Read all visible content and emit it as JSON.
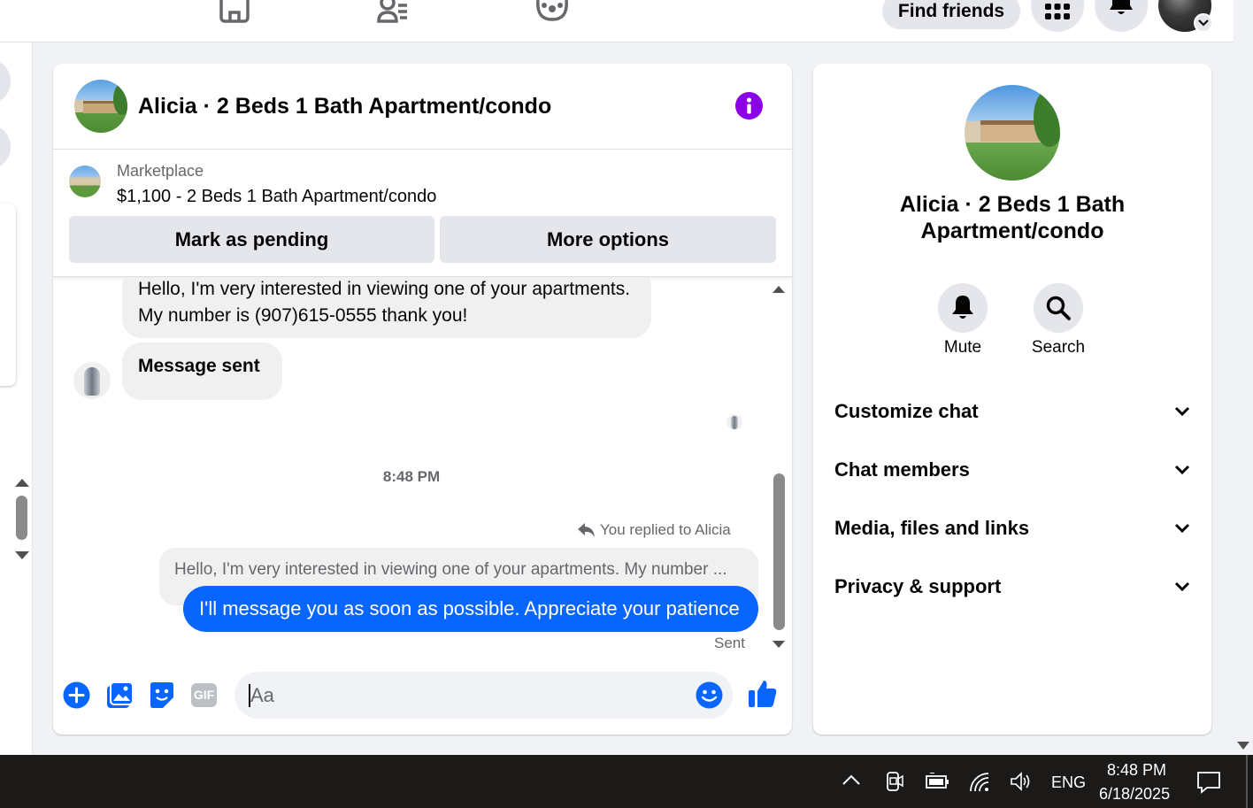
{
  "topbar": {
    "find_friends": "Find friends",
    "nav_icons": [
      "home-icon",
      "friends-icon",
      "groups-icon"
    ],
    "right_icons": [
      "menu-grid-icon",
      "notifications-bell-icon",
      "account-avatar"
    ]
  },
  "chat": {
    "header_title": "Alicia · 2 Beds 1 Bath Apartment/condo",
    "marketplace_label": "Marketplace",
    "listing_text": "$1,100 - 2 Beds 1 Bath Apartment/condo",
    "mark_pending": "Mark as pending",
    "more_options": "More options",
    "messages": [
      {
        "type": "received",
        "text": "Hello, I'm very interested in viewing one of your apartments. My number is (907)615-0555 thank you!"
      },
      {
        "type": "received",
        "text": "Message sent"
      }
    ],
    "timestamp": "8:48 PM",
    "reply_label": "You replied to Alicia",
    "quoted_text": "Hello, I'm very interested in viewing one of your apartments. My number ...",
    "sent_message": "I'll message you as soon as possible. Appreciate your patience",
    "sent_status": "Sent",
    "composer_placeholder": "Aa",
    "accent_color": "#0866ff"
  },
  "info": {
    "title": "Alicia · 2 Beds 1 Bath Apartment/condo",
    "mute": "Mute",
    "search": "Search",
    "sections": [
      "Customize chat",
      "Chat members",
      "Media, files and links",
      "Privacy & support"
    ]
  },
  "taskbar": {
    "language": "ENG",
    "time": "8:48 PM",
    "date": "6/18/2025"
  }
}
